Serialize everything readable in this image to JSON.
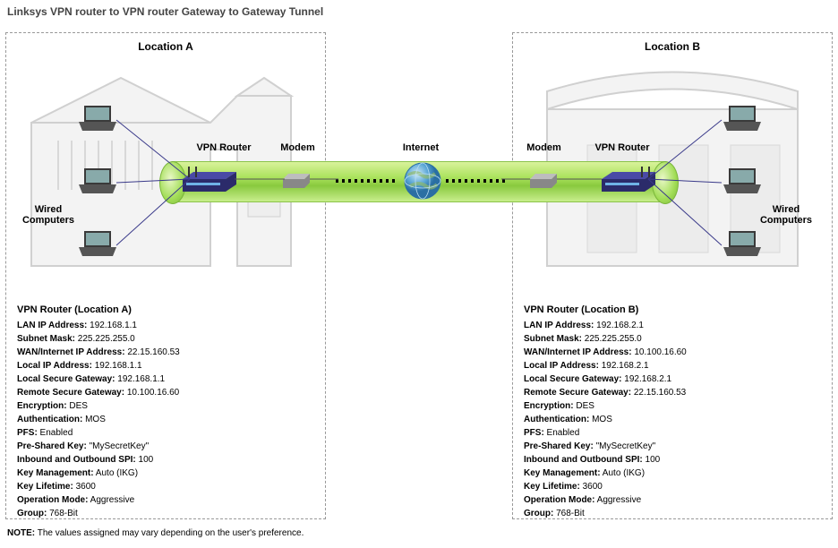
{
  "title": "Linksys VPN router to VPN router Gateway to Gateway Tunnel",
  "labels": {
    "locA": "Location A",
    "locB": "Location B",
    "wired": "Wired Computers",
    "vpnRouter": "VPN Router",
    "modem": "Modem",
    "internet": "Internet"
  },
  "configA": {
    "header": "VPN Router (Location A)",
    "rows": [
      {
        "k": "LAN IP Address:",
        "v": " 192.168.1.1"
      },
      {
        "k": "Subnet Mask:",
        "v": " 225.225.255.0"
      },
      {
        "k": "WAN/Internet IP Address:",
        "v": " 22.15.160.53"
      },
      {
        "k": "Local IP Address:",
        "v": " 192.168.1.1"
      },
      {
        "k": "Local Secure Gateway:",
        "v": " 192.168.1.1"
      },
      {
        "k": "Remote Secure Gateway:",
        "v": " 10.100.16.60"
      },
      {
        "k": "Encryption:",
        "v": " DES"
      },
      {
        "k": "Authentication:",
        "v": " MOS"
      },
      {
        "k": "PFS:",
        "v": " Enabled"
      },
      {
        "k": "Pre-Shared Key:",
        "v": " \"MySecretKey\""
      },
      {
        "k": "Inbound and Outbound SPI:",
        "v": " 100"
      },
      {
        "k": "Key Management:",
        "v": " Auto (IKG)"
      },
      {
        "k": "Key Lifetime:",
        "v": " 3600"
      },
      {
        "k": "Operation Mode:",
        "v": " Aggressive"
      },
      {
        "k": "Group:",
        "v": " 768-Bit"
      }
    ]
  },
  "configB": {
    "header": "VPN Router (Location B)",
    "rows": [
      {
        "k": "LAN IP Address:",
        "v": " 192.168.2.1"
      },
      {
        "k": "Subnet Mask:",
        "v": " 225.225.255.0"
      },
      {
        "k": "WAN/Internet IP Address:",
        "v": " 10.100.16.60"
      },
      {
        "k": "Local IP Address:",
        "v": " 192.168.2.1"
      },
      {
        "k": "Local Secure Gateway:",
        "v": " 192.168.2.1"
      },
      {
        "k": "Remote Secure Gateway:",
        "v": " 22.15.160.53"
      },
      {
        "k": "Encryption:",
        "v": " DES"
      },
      {
        "k": "Authentication:",
        "v": " MOS"
      },
      {
        "k": "PFS:",
        "v": " Enabled"
      },
      {
        "k": "Pre-Shared Key:",
        "v": " \"MySecretKey\""
      },
      {
        "k": "Inbound and Outbound SPI:",
        "v": " 100"
      },
      {
        "k": "Key Management:",
        "v": " Auto (IKG)"
      },
      {
        "k": "Key Lifetime:",
        "v": " 3600"
      },
      {
        "k": "Operation Mode:",
        "v": " Aggressive"
      },
      {
        "k": "Group:",
        "v": " 768-Bit"
      }
    ]
  },
  "note": {
    "bold": "NOTE:",
    "text": " The values assigned may vary depending on the user's preference."
  }
}
